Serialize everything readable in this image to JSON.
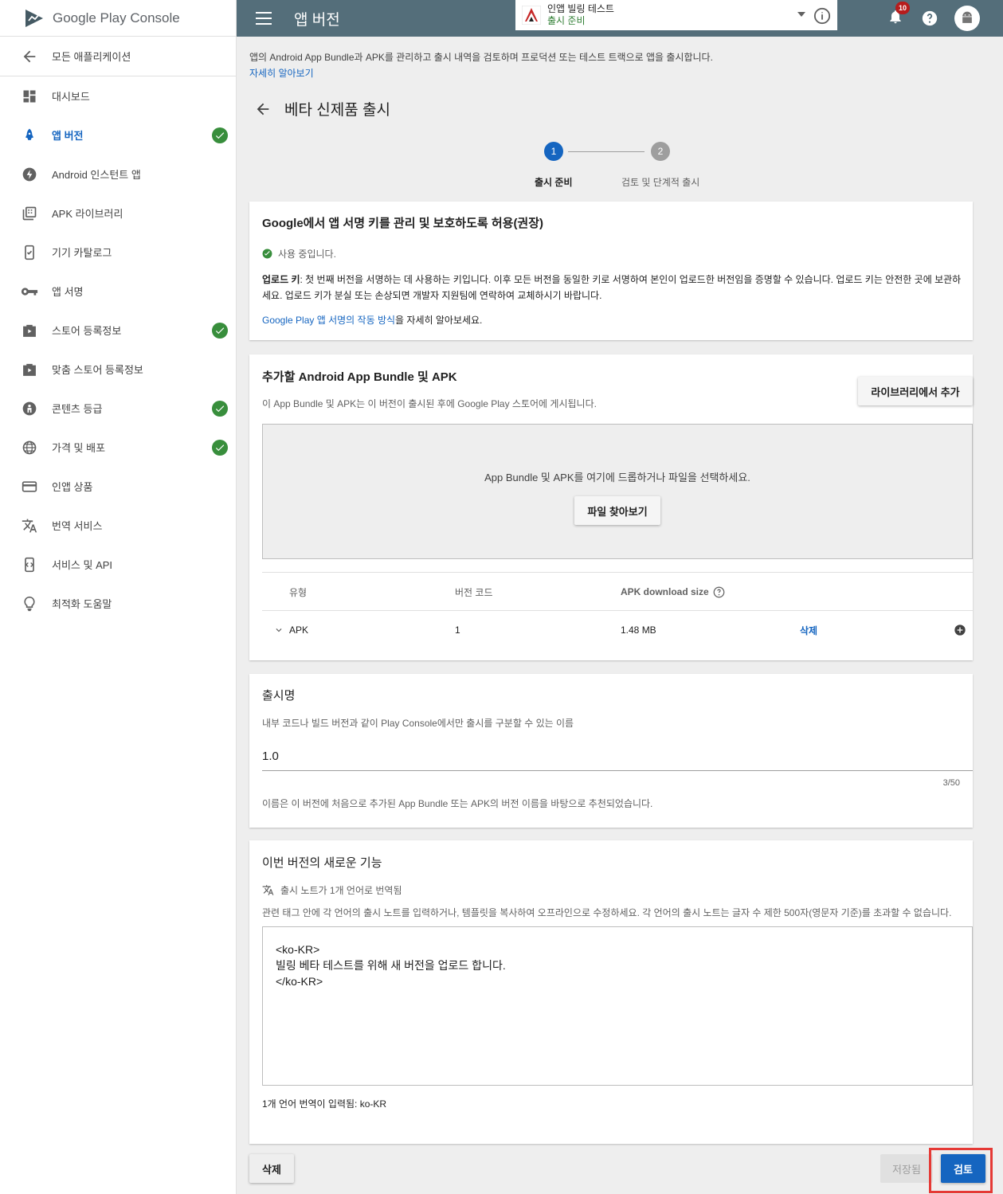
{
  "brand": {
    "name": "Google Play Console"
  },
  "sidebar": {
    "back_label": "모든 애플리케이션",
    "items": [
      {
        "label": "대시보드",
        "icon": "dashboard-icon",
        "active": false,
        "done": false
      },
      {
        "label": "앱 버전",
        "icon": "rocket-icon",
        "active": true,
        "done": true
      },
      {
        "label": "Android 인스턴트 앱",
        "icon": "flash-icon",
        "active": false,
        "done": false
      },
      {
        "label": "APK 라이브러리",
        "icon": "library-icon",
        "active": false,
        "done": false
      },
      {
        "label": "기기 카탈로그",
        "icon": "device-catalog-icon",
        "active": false,
        "done": false
      },
      {
        "label": "앱 서명",
        "icon": "key-icon",
        "active": false,
        "done": false
      },
      {
        "label": "스토어 등록정보",
        "icon": "store-listing-icon",
        "active": false,
        "done": true
      },
      {
        "label": "맞춤 스토어 등록정보",
        "icon": "custom-listing-icon",
        "active": false,
        "done": false
      },
      {
        "label": "콘텐츠 등급",
        "icon": "content-rating-icon",
        "active": false,
        "done": true
      },
      {
        "label": "가격 및 배포",
        "icon": "globe-icon",
        "active": false,
        "done": true
      },
      {
        "label": "인앱 상품",
        "icon": "credit-card-icon",
        "active": false,
        "done": false
      },
      {
        "label": "번역 서비스",
        "icon": "translate-icon",
        "active": false,
        "done": false
      },
      {
        "label": "서비스 및 API",
        "icon": "api-icon",
        "active": false,
        "done": false
      },
      {
        "label": "최적화 도움말",
        "icon": "lightbulb-icon",
        "active": false,
        "done": false
      }
    ]
  },
  "topbar": {
    "title": "앱 버전",
    "app_name": "인앱 빌링 테스트",
    "app_status": "출시 준비",
    "notification_count": "10"
  },
  "intro": {
    "text": "앱의 Android App Bundle과 APK를 관리하고 출시 내역을 검토하며 프로덕션 또는 테스트 트랙으로 앱을 출시합니다.",
    "link": "자세히 알아보기"
  },
  "page": {
    "title": "베타 신제품 출시"
  },
  "stepper": {
    "steps": [
      {
        "number": "1",
        "label": "출시 준비"
      },
      {
        "number": "2",
        "label": "검토 및 단계적 출시"
      }
    ]
  },
  "signing": {
    "title": "Google에서 앱 서명 키를 관리 및 보호하도록 허용(권장)",
    "status": "사용 중입니다.",
    "upload_key_label": "업로드 키",
    "upload_key_text": ": 첫 번째 버전을 서명하는 데 사용하는 키입니다. 이후 모든 버전을 동일한 키로 서명하여 본인이 업로드한 버전임을 증명할 수 있습니다. 업로드 키는 안전한 곳에 보관하세요. 업로드 키가 분실 또는 손상되면 개발자 지원팀에 연락하여 교체하시기 바랍니다.",
    "link": "Google Play 앱 서명의 작동 방식",
    "link_suffix": "을 자세히 알아보세요."
  },
  "bundles": {
    "title": "추가할 Android App Bundle 및 APK",
    "subtitle": "이 App Bundle 및 APK는 이 버전이 출시된 후에 Google Play 스토어에 게시됩니다.",
    "add_from_library": "라이브러리에서 추가",
    "drop_text": "App Bundle 및 APK를 여기에 드롭하거나 파일을 선택하세요.",
    "browse_button": "파일 찾아보기",
    "columns": {
      "type": "유형",
      "version_code": "버전 코드",
      "size": "APK download size"
    },
    "rows": [
      {
        "type": "APK",
        "version_code": "1",
        "size": "1.48 MB",
        "delete": "삭제"
      }
    ]
  },
  "release_name": {
    "title": "출시명",
    "subtitle": "내부 코드나 빌드 버전과 같이 Play Console에서만 출시를 구분할 수 있는 이름",
    "value": "1.0",
    "counter": "3/50",
    "hint": "이름은 이 버전에 처음으로 추가된 App Bundle 또는 APK의 버전 이름을 바탕으로 추천되었습니다."
  },
  "whats_new": {
    "title": "이번 버전의 새로운 기능",
    "translated": "출시 노트가 1개 언어로 번역됨",
    "instructions": "관련 태그 안에 각 언어의 출시 노트를 입력하거나, 템플릿을 복사하여 오프라인으로 수정하세요. 각 언어의 출시 노트는 글자 수 제한 500자(영문자 기준)를 초과할 수 없습니다.",
    "notes": "<ko-KR>\n빌링 베타 테스트를 위해 새 버전을 업로드 합니다.\n</ko-KR>",
    "entered": "1개 언어 번역이 입력됨: ko-KR"
  },
  "footer": {
    "delete": "삭제",
    "saved": "저장됨",
    "review": "검토"
  },
  "colors": {
    "accent": "#1565c0",
    "topbar": "#546e7a",
    "success": "#388e3c",
    "highlight": "#e53935"
  }
}
